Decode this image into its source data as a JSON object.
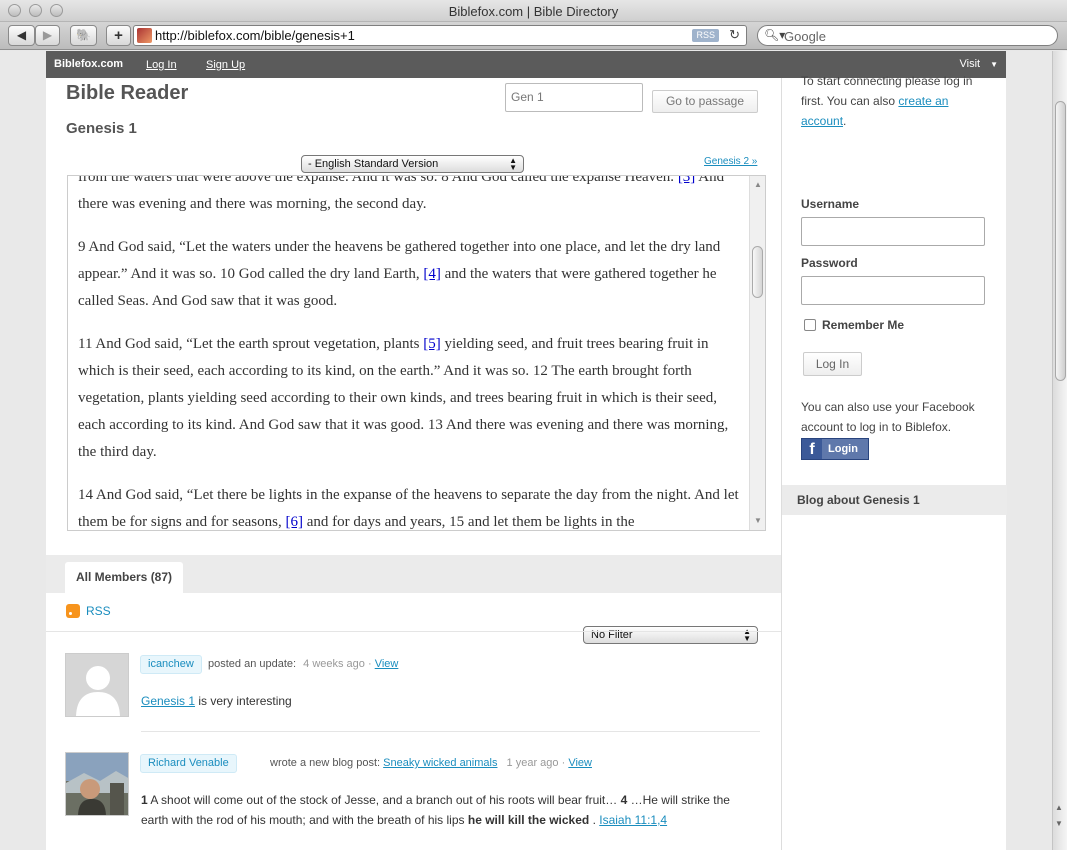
{
  "window": {
    "title": "Biblefox.com | Bible Directory"
  },
  "browser": {
    "url": "http://biblefox.com/bible/genesis+1",
    "rss_chip": "RSS",
    "search_placeholder": "Google"
  },
  "admin_bar": {
    "brand": "Biblefox.com",
    "links": [
      "Log In",
      "Sign Up"
    ],
    "visit": "Visit"
  },
  "reader": {
    "title": "Bible Reader",
    "chapter": "Genesis 1",
    "passage_input_value": "Gen 1",
    "go_button": "Go to passage",
    "version": "- English Standard Version",
    "next_chapter": "Genesis 2 »"
  },
  "passage": {
    "p1": {
      "text": "from the waters that were above the expanse. And it was so. 8 And God called the expanse Heaven. ",
      "fn": "[3]",
      "tail": " And there was evening and there was morning, the second day."
    },
    "p2": {
      "text": "9 And God said, “Let the waters under the heavens be gathered together into one place, and let the dry land appear.” And it was so. 10 God called the dry land Earth, ",
      "fn": "[4]",
      "tail": " and the waters that were gathered together he called Seas. And God saw that it was good."
    },
    "p3": {
      "text": "11 And God said, “Let the earth sprout vegetation, plants ",
      "fn": "[5]",
      "tail": " yielding seed, and fruit trees bearing fruit in which is their seed, each according to its kind, on the earth.” And it was so. 12 The earth brought forth vegetation, plants yielding seed according to their own kinds, and trees bearing fruit in which is their seed, each according to its kind. And God saw that it was good. 13 And there was evening and there was morning, the third day."
    },
    "p4": {
      "text": "14 And God said, “Let there be lights in the expanse of the heavens to separate the day from the night. And let them be for signs and for seasons, ",
      "fn": "[6]",
      "tail": " and for days and years, 15 and let them be lights in the"
    }
  },
  "members": {
    "tab": "All Members (87)",
    "rss": "RSS",
    "filter": "No Filter"
  },
  "activities": [
    {
      "user": "icanchew",
      "action": "posted an update:",
      "time": "4 weeks ago",
      "sep": "·",
      "view": "View",
      "body_link": "Genesis 1",
      "body_text": " is very interesting"
    },
    {
      "user": "Richard Venable",
      "action": "wrote a new blog post:",
      "post_link": "Sneaky wicked animals",
      "time": "1 year ago",
      "sep": "·",
      "view": "View",
      "line1_b1": "1",
      "line1_t1": " A shoot will come out of the stock of Jesse, and a branch out of his roots will bear fruit… ",
      "line1_b2": "4",
      "line1_t2": " …He will strike the",
      "line2_t": "earth with the rod of his mouth; and with the breath of his lips ",
      "line2_b": "he will kill the wicked",
      "line2_sp": " . ",
      "line2_link": "Isaiah 11:1,4"
    }
  ],
  "sidebar": {
    "intro": "To start connecting please log in first. You can also ",
    "intro_link": "create an account",
    "intro_end": ".",
    "username_label": "Username",
    "password_label": "Password",
    "remember": "Remember Me",
    "login_button": "Log In",
    "facebook_text": "You can also use your Facebook account to log in to Biblefox.",
    "facebook_button": "Login",
    "blog_heading": "Blog about Genesis 1"
  }
}
